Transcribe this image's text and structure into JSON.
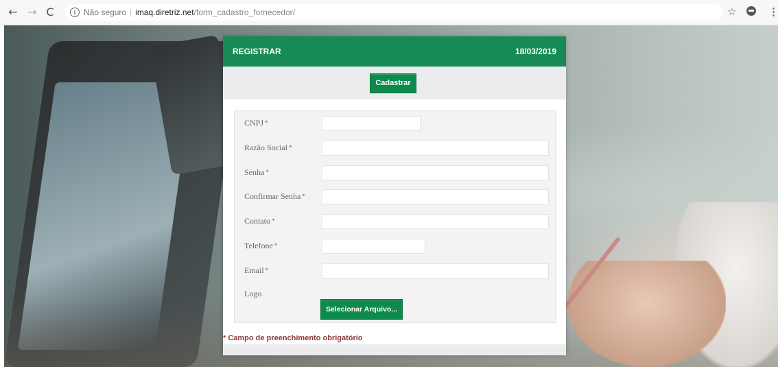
{
  "browser": {
    "back_icon": "arrow-left-icon",
    "forward_icon": "arrow-right-icon",
    "reload_icon": "reload-icon",
    "security_label": "Não seguro",
    "url_host": "imaq.diretriz.net",
    "url_path": "/form_cadastro_fornecedor/",
    "bookmark_icon": "star-icon",
    "account_icon": "account-icon",
    "menu_icon": "kebab-menu-icon"
  },
  "header": {
    "title": "REGISTRAR",
    "date": "18/03/2019",
    "color": "#188a55"
  },
  "actions": {
    "submit_label": "Cadastrar"
  },
  "form": {
    "fields": [
      {
        "label": "CNPJ",
        "required": "*",
        "value": ""
      },
      {
        "label": "Razão Social",
        "required": "*",
        "value": ""
      },
      {
        "label": "Senha",
        "required": "*",
        "value": ""
      },
      {
        "label": "Confirmar Senha",
        "required": "*",
        "value": ""
      },
      {
        "label": "Contato",
        "required": "*",
        "value": ""
      },
      {
        "label": "Telefone",
        "required": "*",
        "value": ""
      },
      {
        "label": "Email",
        "required": "*",
        "value": ""
      }
    ],
    "logo": {
      "label": "Logo",
      "button_label": "Selecionar Arquivo..."
    }
  },
  "note": {
    "asterisk": "*",
    "text": " Campo de preenchimento obrigatório"
  }
}
